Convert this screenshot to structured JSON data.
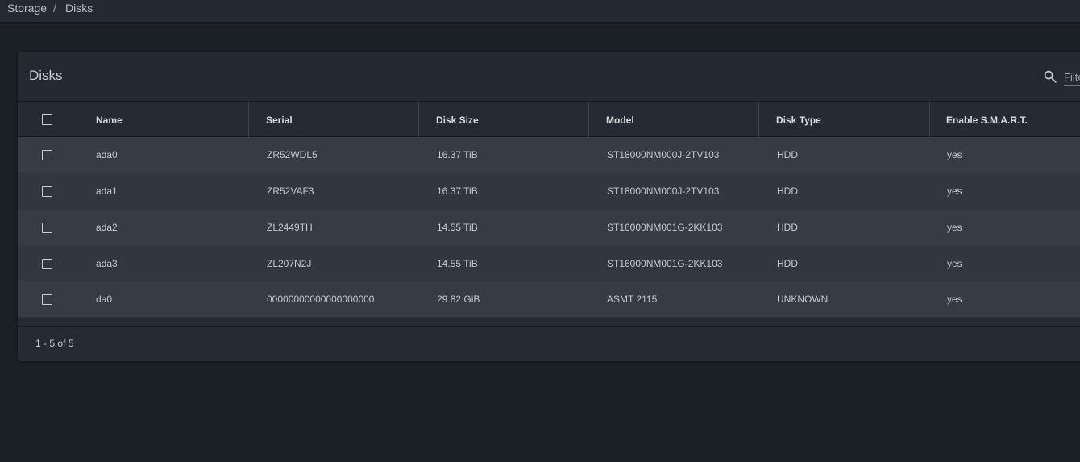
{
  "breadcrumb": {
    "items": [
      "Storage",
      "Disks"
    ],
    "separator": "/"
  },
  "card": {
    "title": "Disks",
    "filter_placeholder": "Filter"
  },
  "table": {
    "columns": [
      "Name",
      "Serial",
      "Disk Size",
      "Model",
      "Disk Type",
      "Enable S.M.A.R.T."
    ],
    "rows": [
      {
        "name": "ada0",
        "serial": "ZR52WDL5",
        "size": "16.37 TiB",
        "model": "ST18000NM000J-2TV103",
        "type": "HDD",
        "smart": "yes"
      },
      {
        "name": "ada1",
        "serial": "ZR52VAF3",
        "size": "16.37 TiB",
        "model": "ST18000NM000J-2TV103",
        "type": "HDD",
        "smart": "yes"
      },
      {
        "name": "ada2",
        "serial": "ZL2449TH",
        "size": "14.55 TiB",
        "model": "ST16000NM001G-2KK103",
        "type": "HDD",
        "smart": "yes"
      },
      {
        "name": "ada3",
        "serial": "ZL207N2J",
        "size": "14.55 TiB",
        "model": "ST16000NM001G-2KK103",
        "type": "HDD",
        "smart": "yes"
      },
      {
        "name": "da0",
        "serial": "00000000000000000000",
        "size": "29.82 GiB",
        "model": "ASMT 2115",
        "type": "UNKNOWN",
        "smart": "yes"
      }
    ]
  },
  "paginator": {
    "range_label": "1 - 5 of 5"
  },
  "icons": {
    "search": "search-icon"
  }
}
